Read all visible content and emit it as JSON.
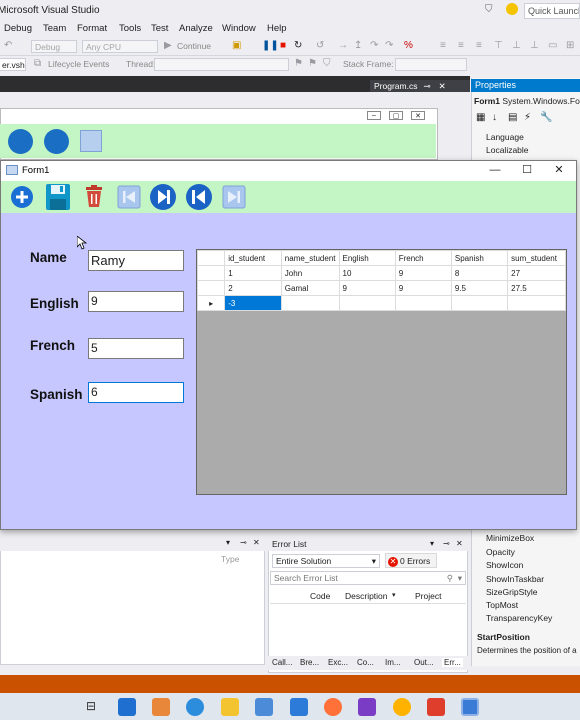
{
  "vs": {
    "title": "Microsoft Visual Studio",
    "quick_launch_placeholder": "Quick Launch",
    "menu": [
      "Debug",
      "Team",
      "Format",
      "Tools",
      "Test",
      "Analyze",
      "Window",
      "Help"
    ],
    "toolbar": {
      "config": "Debug",
      "platform": "Any CPU",
      "continue_label": "Continue",
      "file_dropdown": "er.vsh",
      "lifecycle": "Lifecycle Events",
      "thread": "Thread:",
      "stack_frame": "Stack Frame:"
    },
    "editor_tab": "Program.cs"
  },
  "properties": {
    "header": "Properties",
    "object": "Form1",
    "object_type": "System.Windows.Fo",
    "rows_top": [
      "Language",
      "Localizable"
    ],
    "rows_bottom": [
      "MinimizeBox",
      "Opacity",
      "ShowIcon",
      "ShowInTaskbar",
      "SizeGripStyle",
      "TopMost",
      "TransparencyKey"
    ],
    "desc_title": "StartPosition",
    "desc_text": "Determines the position of a"
  },
  "output_panel": {
    "type_col": "Type"
  },
  "error_list": {
    "title": "Error List",
    "scope": "Entire Solution",
    "errors_label": "0 Errors",
    "search_placeholder": "Search Error List",
    "columns": [
      "Code",
      "Description",
      "Project"
    ],
    "tabs": [
      "Call...",
      "Bre...",
      "Exc...",
      "Co...",
      "Im...",
      "Out...",
      "Err..."
    ]
  },
  "form1": {
    "title": "Form1",
    "fields": {
      "name_label": "Name",
      "name_value": "Ramy",
      "english_label": "English",
      "english_value": "9",
      "french_label": "French",
      "french_value": "5",
      "spanish_label": "Spanish",
      "spanish_value": "6"
    },
    "grid": {
      "columns": [
        "id_student",
        "name_student",
        "English",
        "French",
        "Spanish",
        "sum_student"
      ],
      "rows": [
        [
          "1",
          "John",
          "10",
          "9",
          "8",
          "27"
        ],
        [
          "2",
          "Gamal",
          "9",
          "9",
          "9.5",
          "27.5"
        ],
        [
          "-3",
          "",
          "",
          "",
          "",
          ""
        ]
      ]
    }
  },
  "colors": {
    "toolbar_green": "#c4f5c4",
    "form_body": "#c7c7ff",
    "selection_blue": "#0078d7",
    "status_orange": "#ca5100",
    "vs_blue": "#007acc"
  }
}
